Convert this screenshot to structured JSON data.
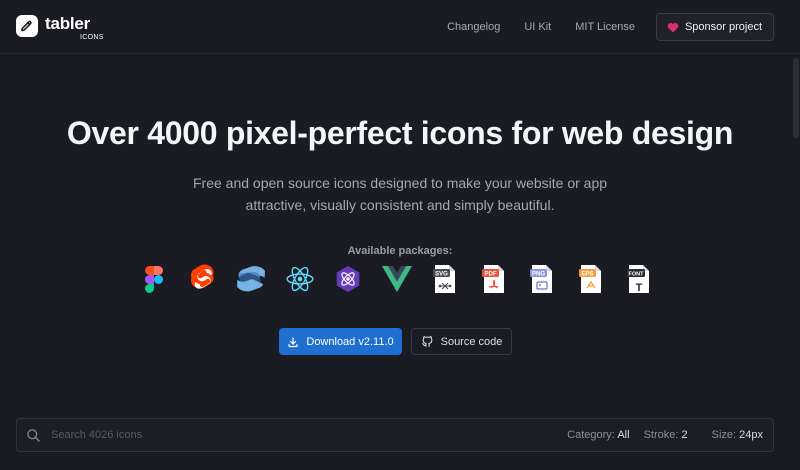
{
  "header": {
    "logo_word": "tabler",
    "logo_sub": "ICONS",
    "nav": [
      "Changelog",
      "UI Kit",
      "MIT License"
    ],
    "sponsor_label": "Sponsor project"
  },
  "hero": {
    "title": "Over 4000 pixel-perfect icons for web design",
    "subtitle": "Free and open source icons designed to make your website or app attractive, visually consistent and simply beautiful.",
    "packages_label": "Available packages:"
  },
  "packages": [
    {
      "icon": "figma-icon"
    },
    {
      "icon": "svelte-icon"
    },
    {
      "icon": "solidjs-icon"
    },
    {
      "icon": "react-icon"
    },
    {
      "icon": "preact-icon"
    },
    {
      "icon": "vue-icon"
    },
    {
      "icon": "svg-file-icon",
      "badge": "SVG"
    },
    {
      "icon": "pdf-file-icon",
      "badge": "PDF"
    },
    {
      "icon": "png-file-icon",
      "badge": "PNG"
    },
    {
      "icon": "eps-file-icon",
      "badge": "EPS"
    },
    {
      "icon": "font-file-icon",
      "badge": "FONT",
      "glyph": "T"
    }
  ],
  "actions": {
    "download_label": "Download v2.11.0",
    "source_label": "Source code"
  },
  "search": {
    "placeholder": "Search 4026 icons",
    "category_label": "Category:",
    "category_value": "All",
    "stroke_label": "Stroke:",
    "stroke_value": "2",
    "size_label": "Size:",
    "size_value": "24px"
  },
  "colors": {
    "background": "#1a1b23",
    "primary": "#1f6fd0",
    "heart": "#d6336c"
  }
}
